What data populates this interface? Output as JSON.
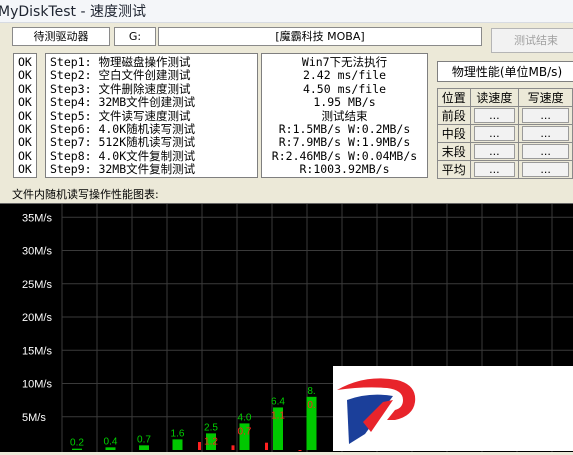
{
  "window": {
    "title": "MyDiskTest - 速度测试"
  },
  "drive": {
    "status_label": "待测驱动器",
    "letter": "G:",
    "name": "[魔霸科技 MOBA]",
    "end_button": "测试结束"
  },
  "steps": [
    {
      "status": "OK",
      "name": "Step1: 物理磁盘操作测试",
      "result": "Win7下无法执行"
    },
    {
      "status": "OK",
      "name": "Step2: 空白文件创建测试",
      "result": "2.42 ms/file"
    },
    {
      "status": "OK",
      "name": "Step3: 文件删除速度测试",
      "result": "4.50 ms/file"
    },
    {
      "status": "OK",
      "name": "Step4: 32MB文件创建测试",
      "result": "1.95 MB/s"
    },
    {
      "status": "OK",
      "name": "Step5: 文件读写速度测试",
      "result": "测试结束"
    },
    {
      "status": "OK",
      "name": "Step6: 4.0K随机读写测试",
      "result": "R:1.5MB/s W:0.2MB/s"
    },
    {
      "status": "OK",
      "name": "Step7: 512K随机读写测试",
      "result": "R:7.9MB/s W:1.9MB/s"
    },
    {
      "status": "OK",
      "name": "Step8: 4.0K文件复制测试",
      "result": "R:2.46MB/s W:0.04MB/s"
    },
    {
      "status": "OK",
      "name": "Step9: 32MB文件复制测试",
      "result": "R:1003.92MB/s"
    }
  ],
  "physical": {
    "title": "物理性能(单位MB/s)",
    "headers": [
      "位置",
      "读速度",
      "写速度"
    ],
    "rows": [
      {
        "label": "前段",
        "read": "...",
        "write": "..."
      },
      {
        "label": "中段",
        "read": "...",
        "write": "..."
      },
      {
        "label": "末段",
        "read": "...",
        "write": "..."
      },
      {
        "label": "平均",
        "read": "...",
        "write": "..."
      }
    ]
  },
  "chart_caption": "文件内随机读写操作性能图表:",
  "chart_data": {
    "type": "bar",
    "ylim": [
      0,
      37
    ],
    "y_ticks": [
      5,
      10,
      15,
      20,
      25,
      30,
      35
    ],
    "y_tick_labels": [
      "5M/s",
      "10M/s",
      "15M/s",
      "20M/s",
      "25M/s",
      "30M/s",
      "35M/s"
    ],
    "grid": true,
    "series": [
      {
        "values": [
          0.2,
          0.4,
          0.7,
          1.6,
          2.5,
          4.0,
          6.4,
          8
        ]
      },
      {
        "values": [
          null,
          null,
          null,
          null,
          1.2,
          0.7,
          1.1,
          0
        ]
      }
    ],
    "labels_green": [
      "0.2",
      "0.4",
      "0.7",
      "1.6",
      "2.5",
      "4.0",
      "6.4",
      "8."
    ],
    "labels_red": [
      "",
      "",
      "",
      "",
      "1.2",
      "0.7",
      "1.1",
      "0."
    ]
  },
  "colors": {
    "read_series": "#00c800",
    "write_series": "#ff2020",
    "grid": "#3a3a3a",
    "logo_red": "#e8242b",
    "logo_blue": "#1b3f9a"
  },
  "logo": {
    "icon": "moba-logo-icon"
  }
}
